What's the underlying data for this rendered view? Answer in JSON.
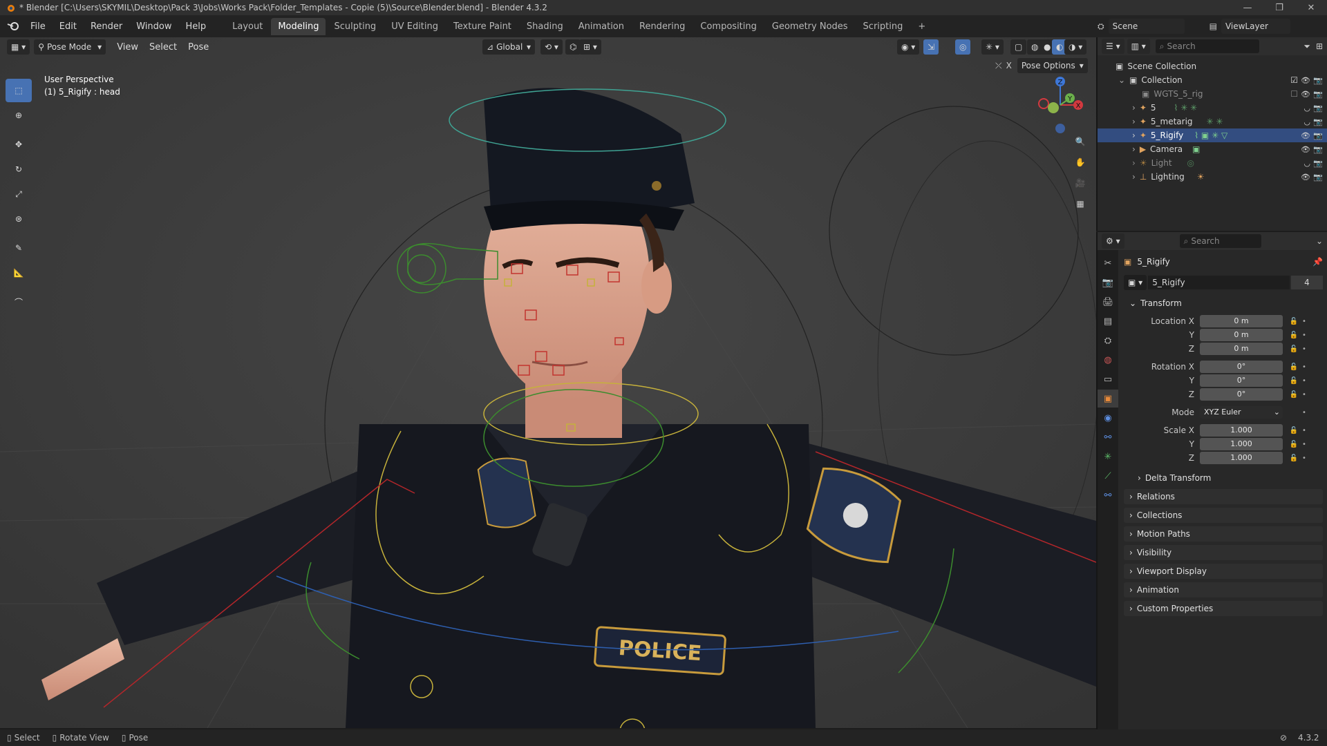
{
  "window": {
    "title": "* Blender [C:\\Users\\SKYMIL\\Desktop\\Pack 3\\Jobs\\Works Pack\\Folder_Templates - Copie (5)\\Source\\Blender.blend] - Blender 4.3.2"
  },
  "menu": {
    "items": [
      "File",
      "Edit",
      "Render",
      "Window",
      "Help"
    ],
    "workspaces": [
      "Layout",
      "Modeling",
      "Sculpting",
      "UV Editing",
      "Texture Paint",
      "Shading",
      "Animation",
      "Rendering",
      "Compositing",
      "Geometry Nodes",
      "Scripting"
    ],
    "active_workspace": "Modeling",
    "scene_label": "Scene",
    "view_layer_label": "ViewLayer"
  },
  "viewport": {
    "mode": "Pose Mode",
    "menus": [
      "View",
      "Select",
      "Pose"
    ],
    "orientation": "Global",
    "pose_options": "Pose Options",
    "perspective": "User Perspective",
    "active_info": "(1) 5_Rigify : head",
    "badge_text": "POLICE",
    "gizmo": {
      "z": "Z",
      "x": "X",
      "y": "Y"
    }
  },
  "outliner": {
    "search_placeholder": "Search",
    "rows": [
      {
        "label": "Scene Collection"
      },
      {
        "label": "Collection"
      },
      {
        "label": "WGTS_5_rig"
      },
      {
        "label": "5"
      },
      {
        "label": "5_metarig"
      },
      {
        "label": "5_Rigify"
      },
      {
        "label": "Camera"
      },
      {
        "label": "Light"
      },
      {
        "label": "Lighting"
      }
    ]
  },
  "properties": {
    "search_placeholder": "Search",
    "object_name": "5_Rigify",
    "datablock_name": "5_Rigify",
    "user_count": "4",
    "transform_label": "Transform",
    "location": {
      "label_x": "Location X",
      "label_y": "Y",
      "label_z": "Z",
      "x": "0 m",
      "y": "0 m",
      "z": "0 m"
    },
    "rotation": {
      "label_x": "Rotation X",
      "label_y": "Y",
      "label_z": "Z",
      "x": "0°",
      "y": "0°",
      "z": "0°"
    },
    "mode": {
      "label": "Mode",
      "value": "XYZ Euler"
    },
    "scale": {
      "label_x": "Scale X",
      "label_y": "Y",
      "label_z": "Z",
      "x": "1.000",
      "y": "1.000",
      "z": "1.000"
    },
    "delta_transform": "Delta Transform",
    "panels": [
      "Relations",
      "Collections",
      "Motion Paths",
      "Visibility",
      "Viewport Display",
      "Animation",
      "Custom Properties"
    ]
  },
  "status": {
    "items": [
      "Select",
      "Rotate View",
      "Pose"
    ],
    "version": "4.3.2"
  },
  "colors": {
    "accent": "#4772b3",
    "selected_row": "#334d80",
    "object_tab": "#e88a3a"
  }
}
